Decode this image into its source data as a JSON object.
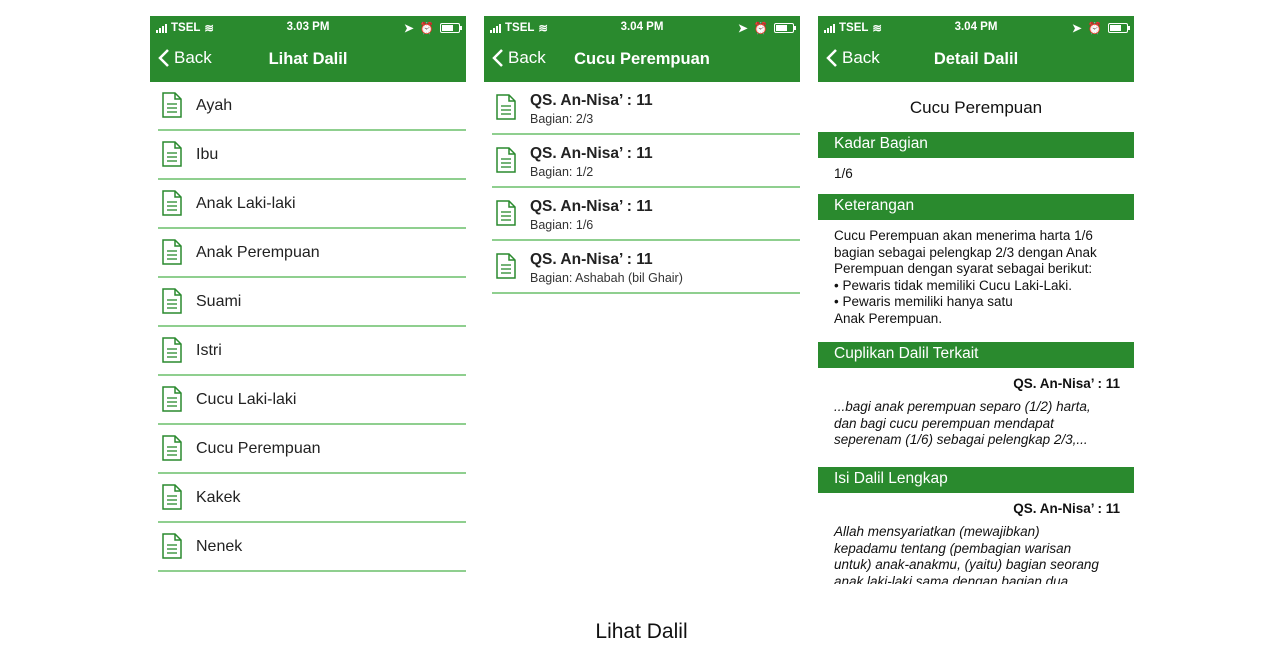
{
  "status": {
    "carrier": "TSEL",
    "time1": "3.03 PM",
    "time2": "3.04 PM",
    "time3": "3.04 PM"
  },
  "back_label": "Back",
  "screen1": {
    "title": "Lihat Dalil",
    "items": [
      "Ayah",
      "Ibu",
      "Anak Laki-laki",
      "Anak Perempuan",
      "Suami",
      "Istri",
      "Cucu Laki-laki",
      "Cucu Perempuan",
      "Kakek",
      "Nenek"
    ]
  },
  "screen2": {
    "title": "Cucu Perempuan",
    "items": [
      {
        "title": "QS. An-Nisa’ : 11",
        "sub": "Bagian: 2/3"
      },
      {
        "title": "QS. An-Nisa’ : 11",
        "sub": "Bagian: 1/2"
      },
      {
        "title": "QS. An-Nisa’ : 11",
        "sub": "Bagian: 1/6"
      },
      {
        "title": "QS. An-Nisa’ : 11",
        "sub": "Bagian: Ashabah (bil Ghair)"
      }
    ]
  },
  "screen3": {
    "title": "Detail Dalil",
    "heading": "Cucu Perempuan",
    "kadar_label": "Kadar Bagian",
    "kadar_value": "1/6",
    "ket_label": "Keterangan",
    "ket_text": "Cucu Perempuan akan menerima harta 1/6\nbagian sebagai pelengkap 2/3 dengan Anak\nPerempuan dengan syarat sebagai berikut:\n• Pewaris tidak memiliki Cucu Laki-Laki.\n• Pewaris memiliki hanya satu\nAnak Perempuan.",
    "cuplikan_label": "Cuplikan Dalil Terkait",
    "cuplikan_ref": "QS. An-Nisa’ : 11",
    "cuplikan_text": "...bagi anak perempuan separo (1/2) harta,\ndan bagi cucu perempuan mendapat\nseperenam (1/6) sebagai pelengkap 2/3,...",
    "isi_label": "Isi Dalil Lengkap",
    "isi_ref": "QS. An-Nisa’ : 11",
    "isi_text": "Allah mensyariatkan (mewajibkan)\nkepadamu tentang (pembagian warisan\nuntuk) anak-anakmu, (yaitu) bagian seorang\nanak laki-laki sama dengan bagian dua"
  },
  "caption": "Lihat Dalil",
  "colors": {
    "accent": "#2a8a2e",
    "divider": "#8fcf8f"
  }
}
